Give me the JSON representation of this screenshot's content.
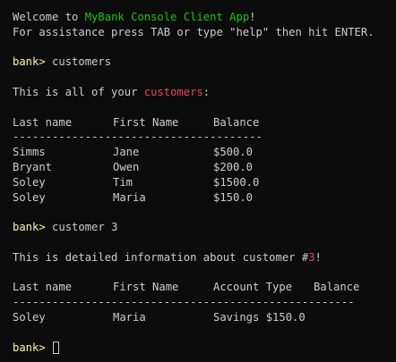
{
  "welcome": {
    "prefix": "Welcome to ",
    "app_name": "MyBank Console Client App",
    "suffix": "!"
  },
  "assistance": "For assistance press TAB or type \"help\" then hit ENTER.",
  "prompt": "bank>",
  "cmd1": {
    "command": "customers",
    "intro_prefix": "This is all of your ",
    "intro_highlight": "customers",
    "intro_suffix": ":",
    "headers": [
      "Last name",
      "First Name",
      "Balance"
    ],
    "separator": "--------------------------------------",
    "rows": [
      [
        "Simms",
        "Jane",
        "$500.0"
      ],
      [
        "Bryant",
        "Owen",
        "$200.0"
      ],
      [
        "Soley",
        "Tim",
        "$1500.0"
      ],
      [
        "Soley",
        "Maria",
        "$150.0"
      ]
    ]
  },
  "cmd2": {
    "command": "customer 3",
    "intro_prefix": "This is detailed information about customer #",
    "intro_highlight": "3",
    "intro_suffix": "!",
    "headers": [
      "Last name",
      "First Name",
      "Account Type",
      "Balance"
    ],
    "separator": "----------------------------------------------------",
    "rows": [
      [
        "Soley",
        "Maria",
        "Savings $150.0"
      ]
    ]
  },
  "colors": {
    "background": "#0c0c0c",
    "text": "#cccccc",
    "prompt": "#f9f1a5",
    "app_name": "#16c60c",
    "highlight": "#e74856"
  }
}
